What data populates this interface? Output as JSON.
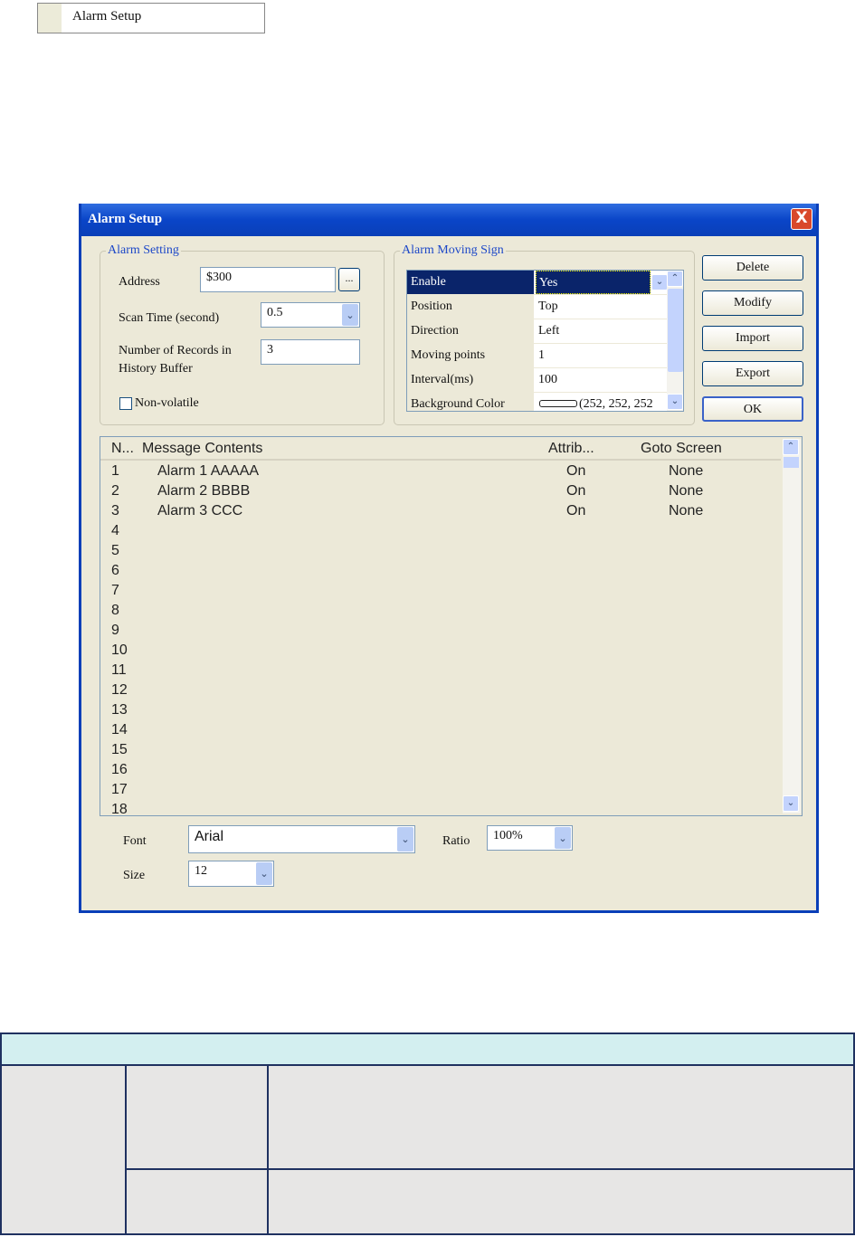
{
  "menu_item": {
    "label": "Alarm Setup"
  },
  "dialog": {
    "title": "Alarm Setup",
    "close": "X",
    "alarm_setting": {
      "legend": "Alarm Setting",
      "address_label": "Address",
      "address_value": "$300",
      "browse_label": "...",
      "scan_time_label": "Scan Time (second)",
      "scan_time_value": "0.5",
      "records_label_1": "Number of Records in",
      "records_label_2": "History Buffer",
      "records_value": "3",
      "nonvolatile_label": "Non-volatile",
      "nonvolatile_checked": false
    },
    "moving_sign": {
      "legend": "Alarm Moving Sign",
      "rows": [
        {
          "name": "Enable",
          "value": "Yes"
        },
        {
          "name": "Position",
          "value": "Top"
        },
        {
          "name": "Direction",
          "value": "Left"
        },
        {
          "name": "Moving points",
          "value": "1"
        },
        {
          "name": "Interval(ms)",
          "value": "100"
        },
        {
          "name": "Background Color",
          "value": "(252, 252, 252"
        }
      ]
    },
    "buttons": {
      "delete": "Delete",
      "modify": "Modify",
      "import": "Import",
      "export": "Export",
      "ok": "OK"
    },
    "list": {
      "columns": [
        "N...",
        "Message Contents",
        "Attrib...",
        "Goto Screen"
      ],
      "rows": [
        {
          "n": "1",
          "msg": "Alarm 1 AAAAA",
          "attr": "On",
          "goto": "None"
        },
        {
          "n": "2",
          "msg": "Alarm 2 BBBB",
          "attr": "On",
          "goto": "None"
        },
        {
          "n": "3",
          "msg": "Alarm 3 CCC",
          "attr": "On",
          "goto": "None"
        },
        {
          "n": "4",
          "msg": "",
          "attr": "",
          "goto": ""
        },
        {
          "n": "5",
          "msg": "",
          "attr": "",
          "goto": ""
        },
        {
          "n": "6",
          "msg": "",
          "attr": "",
          "goto": ""
        },
        {
          "n": "7",
          "msg": "",
          "attr": "",
          "goto": ""
        },
        {
          "n": "8",
          "msg": "",
          "attr": "",
          "goto": ""
        },
        {
          "n": "9",
          "msg": "",
          "attr": "",
          "goto": ""
        },
        {
          "n": "10",
          "msg": "",
          "attr": "",
          "goto": ""
        },
        {
          "n": "11",
          "msg": "",
          "attr": "",
          "goto": ""
        },
        {
          "n": "12",
          "msg": "",
          "attr": "",
          "goto": ""
        },
        {
          "n": "13",
          "msg": "",
          "attr": "",
          "goto": ""
        },
        {
          "n": "14",
          "msg": "",
          "attr": "",
          "goto": ""
        },
        {
          "n": "15",
          "msg": "",
          "attr": "",
          "goto": ""
        },
        {
          "n": "16",
          "msg": "",
          "attr": "",
          "goto": ""
        },
        {
          "n": "17",
          "msg": "",
          "attr": "",
          "goto": ""
        },
        {
          "n": "18",
          "msg": "",
          "attr": "",
          "goto": ""
        }
      ]
    },
    "font_label": "Font",
    "font_value": "Arial",
    "ratio_label": "Ratio",
    "ratio_value": "100%",
    "size_label": "Size",
    "size_value": "12"
  },
  "colors": {
    "titlebar": "#0a45c8",
    "dialog_bg": "#ece9d8",
    "selection": "#0a246a",
    "table_header": "#d3eff0",
    "table_border": "#1f3160"
  }
}
